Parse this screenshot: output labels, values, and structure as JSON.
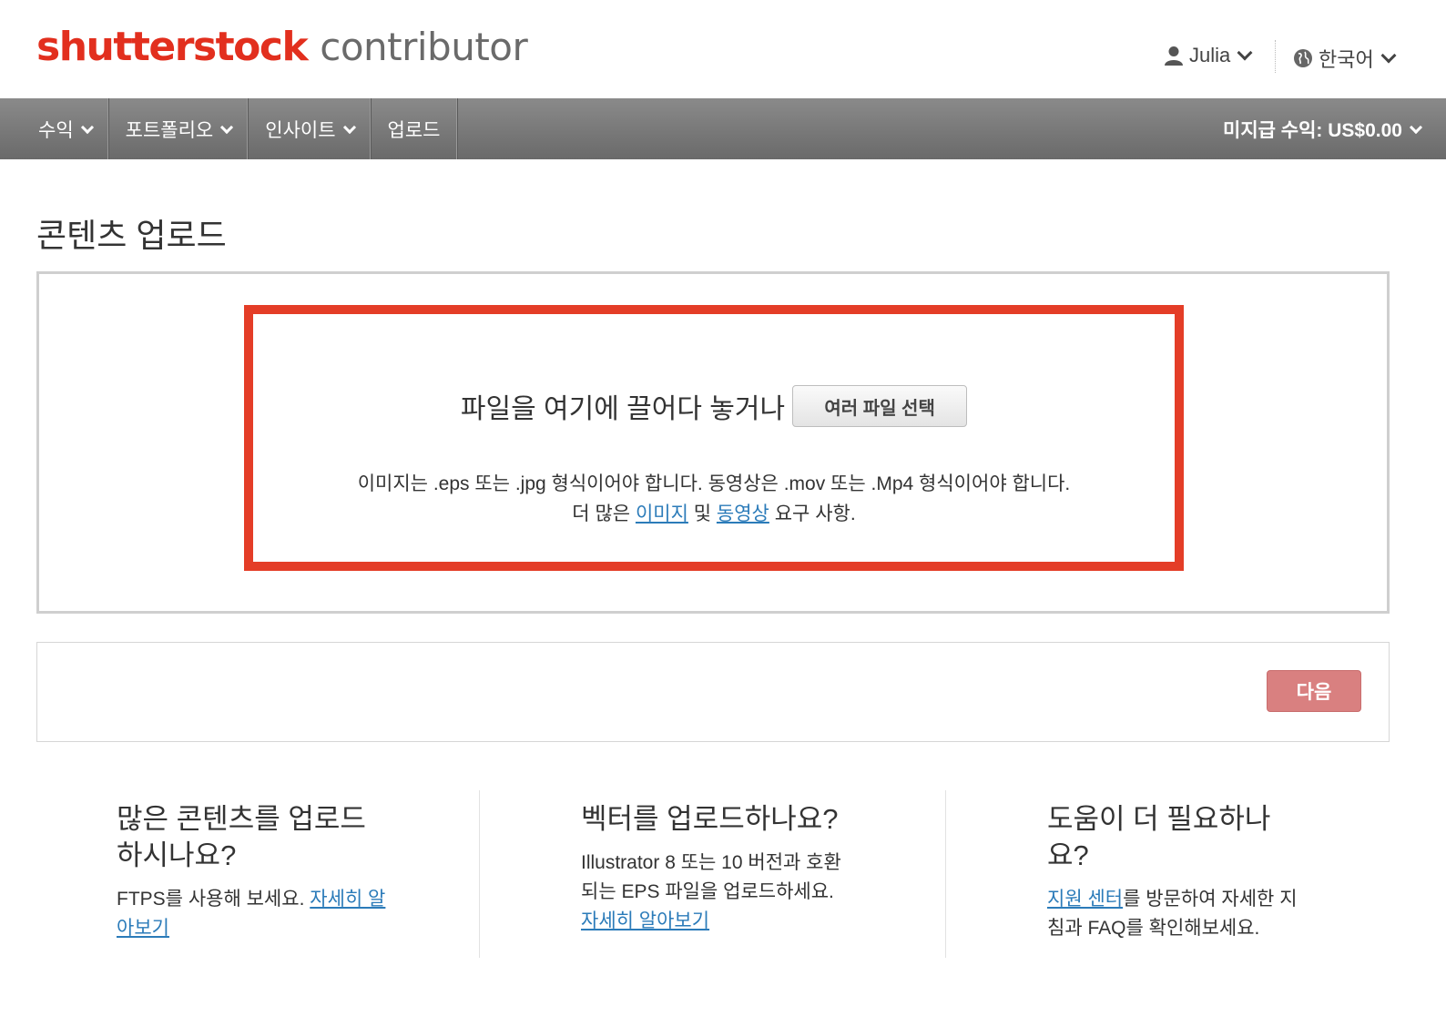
{
  "header": {
    "logo_brand": "shutterstock",
    "logo_sub": "contributor",
    "user_name": "Julia",
    "language": "한국어",
    "brand_color": "#e22f1e"
  },
  "nav": {
    "items": [
      {
        "label": "수익",
        "dropdown": true
      },
      {
        "label": "포트폴리오",
        "dropdown": true
      },
      {
        "label": "인사이트",
        "dropdown": true
      },
      {
        "label": "업로드",
        "dropdown": false
      }
    ],
    "earnings_label": "미지급 수익: US$0.00"
  },
  "page": {
    "title": "콘텐츠 업로드"
  },
  "upload": {
    "drop_text": "파일을 여기에 끌어다 놓거나",
    "select_button": "여러 파일 선택",
    "requirements_text": "이미지는 .eps 또는 .jpg 형식이어야 합니다. 동영상은 .mov 또는 .Mp4 형식이어야 합니다.",
    "more_prefix": "더 많은",
    "image_link": "이미지",
    "and_word": "및",
    "video_link": "동영상",
    "more_suffix": "요구 사항.",
    "highlight_color": "#e43d27"
  },
  "actions": {
    "next_button": "다음"
  },
  "info": {
    "bulk": {
      "title": "많은 콘텐츠를 업로드하시나요?",
      "text": "FTPS를 사용해 보세요.",
      "link": "자세히 알아보기"
    },
    "vector": {
      "title": "벡터를 업로드하나요?",
      "text": "Illustrator 8 또는 10 버전과 호환되는 EPS 파일을 업로드하세요.",
      "link": "자세히 알아보기"
    },
    "help": {
      "title": "도움이 더 필요하나요?",
      "link": "지원 센터",
      "text": "를 방문하여 자세한 지침과 FAQ를 확인해보세요."
    }
  }
}
